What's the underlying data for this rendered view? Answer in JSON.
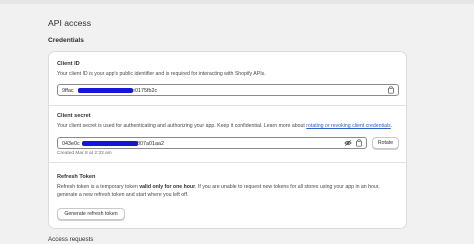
{
  "page": {
    "title": "API access",
    "credentials_heading": "Credentials",
    "access_requests_heading": "Access requests"
  },
  "client_id": {
    "heading": "Client ID",
    "description": "Your client ID is your app's public identifier and is required for interacting with Shopify APIs.",
    "value_start": "9ffac",
    "value_end": "e0175fb2c",
    "copy_icon": "copy-icon"
  },
  "client_secret": {
    "heading": "Client secret",
    "description_prefix": "Your client secret is used for authenticating and authorizing your app. Keep it confidential. Learn more about ",
    "description_link": "rotating or revoking client credentials",
    "description_suffix": ".",
    "value_start": "043e0c",
    "value_end": "807a01aa2",
    "created": "Created Mar 8 at 2:33 am",
    "hide_icon": "eye-slash-icon",
    "copy_icon": "copy-icon",
    "rotate_label": "Rotate"
  },
  "refresh_token": {
    "heading": "Refresh Token",
    "line1_prefix": "Refresh token is a temporary token ",
    "line1_bold": "valid only for one hour",
    "line1_suffix": ". If you are unable to request new tokens for all stores using your app in an hour,",
    "line2": "generate a new refresh token and start where you left off.",
    "button_label": "Generate refresh token"
  },
  "colors": {
    "redaction": "#1616d8",
    "link": "#2a62c9"
  }
}
